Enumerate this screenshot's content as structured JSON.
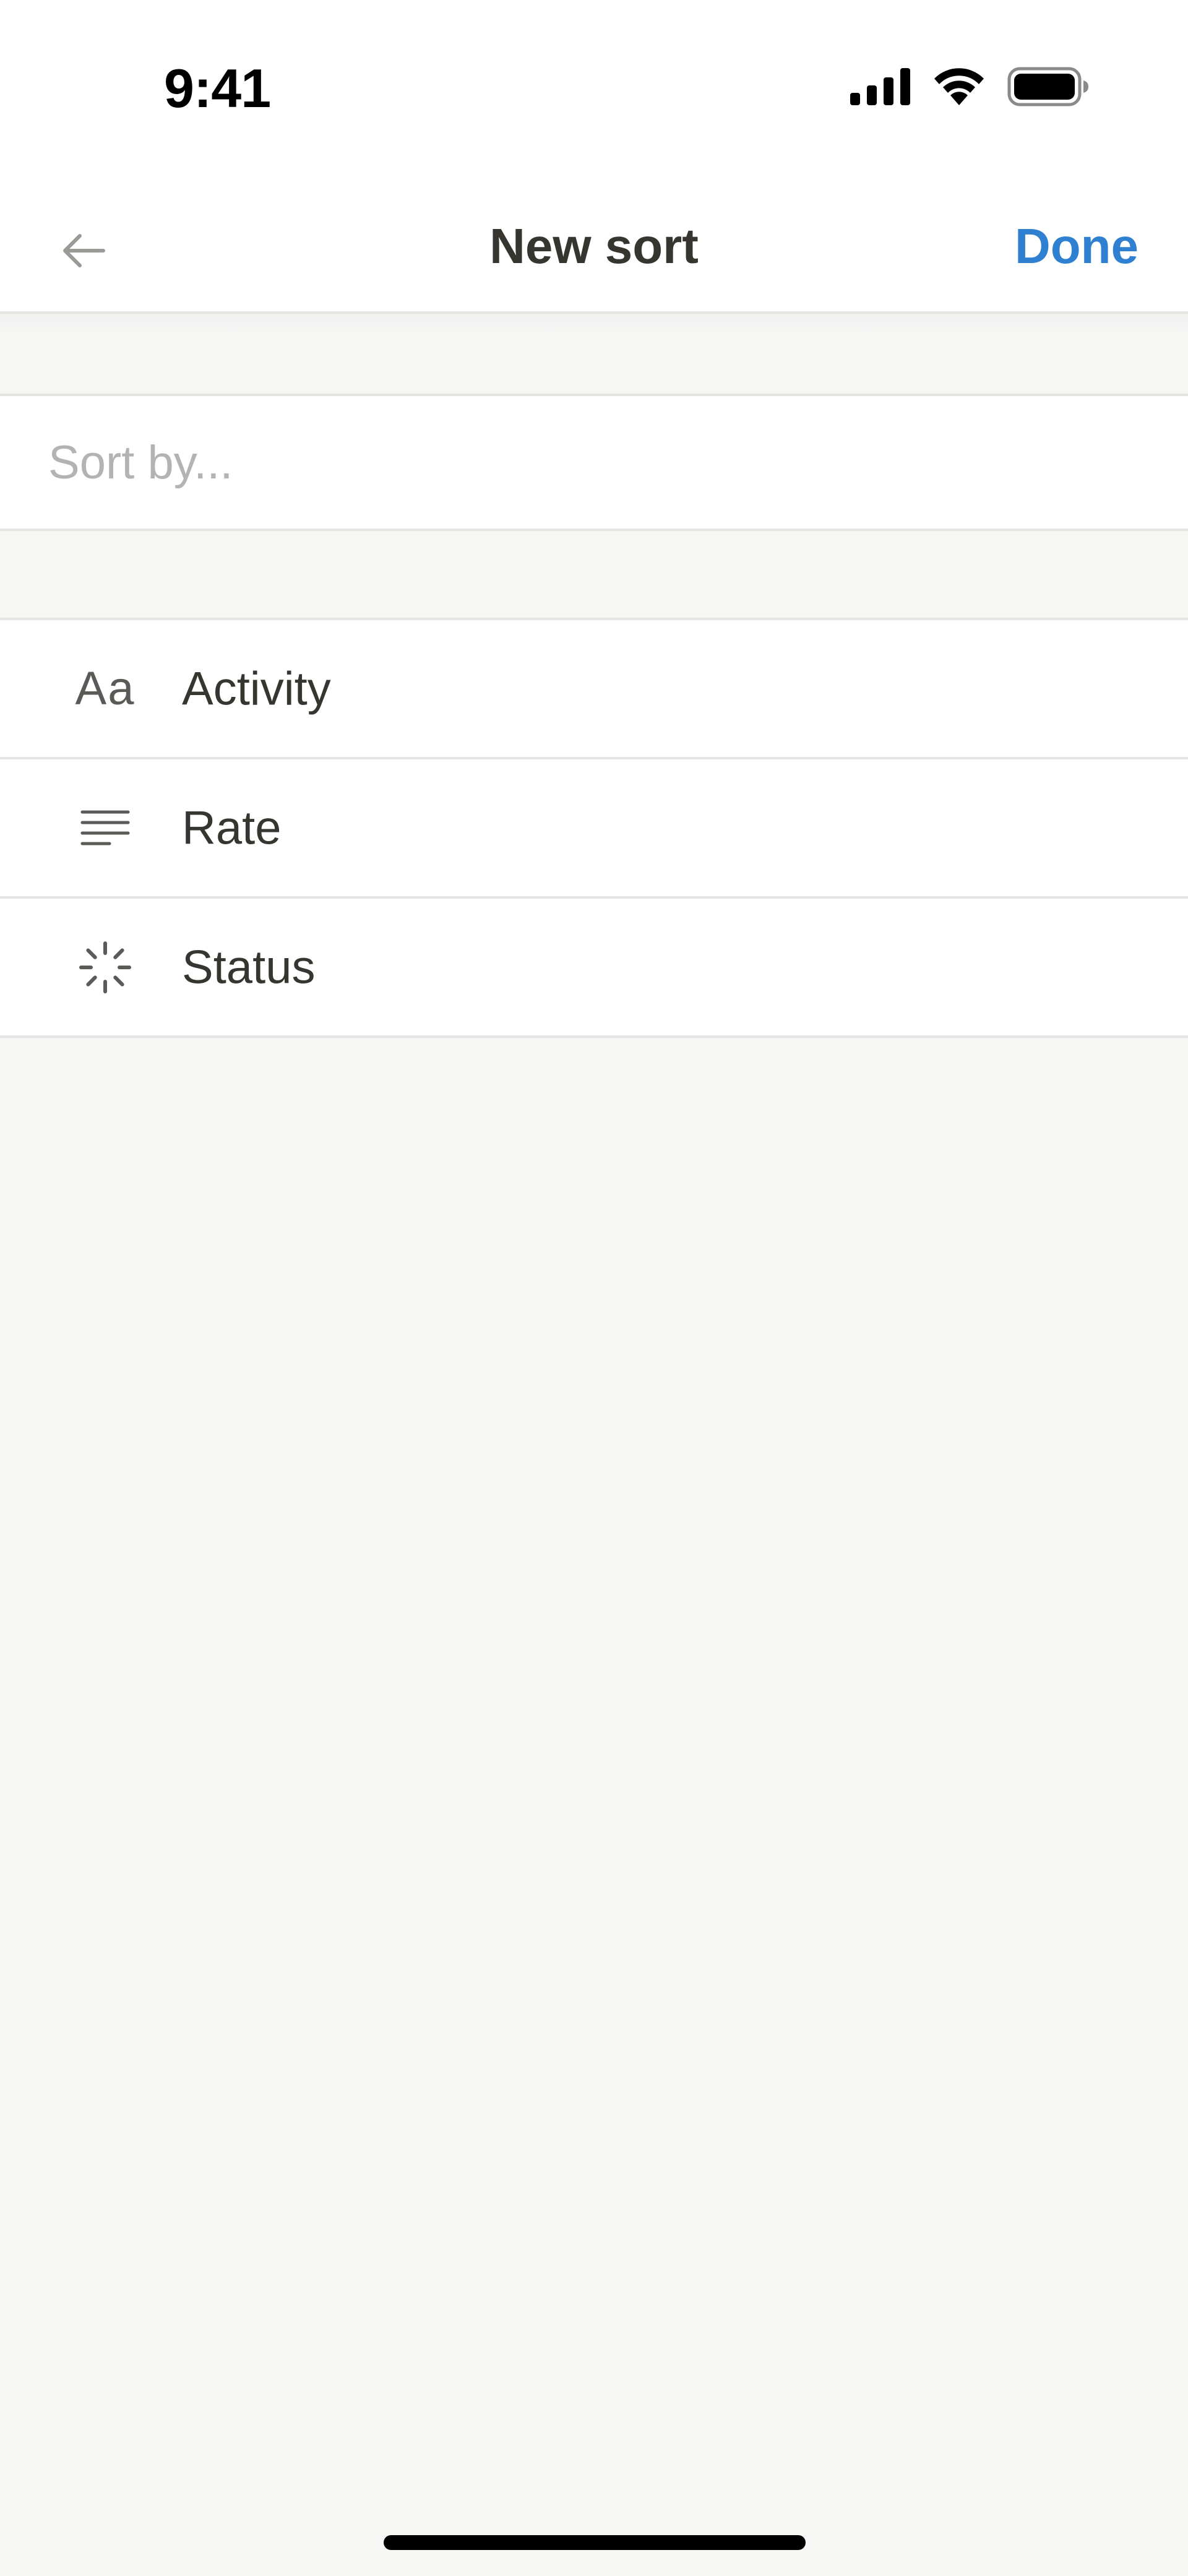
{
  "status_bar": {
    "time": "9:41",
    "icons": [
      "cellular-signal-icon",
      "wifi-icon",
      "battery-icon"
    ]
  },
  "nav": {
    "title": "New sort",
    "done_label": "Done",
    "back_icon": "arrow-left-icon"
  },
  "search": {
    "placeholder": "Sort by..."
  },
  "properties": [
    {
      "icon": "text-type-icon",
      "icon_text": "Aa",
      "label": "Activity"
    },
    {
      "icon": "lines-icon",
      "label": "Rate"
    },
    {
      "icon": "status-loader-icon",
      "label": "Status"
    }
  ],
  "colors": {
    "accent": "#2f80d0",
    "text": "#37352f",
    "background": "#f6f6f5",
    "divider": "#e4e4e2",
    "placeholder": "#b3b3b1"
  }
}
